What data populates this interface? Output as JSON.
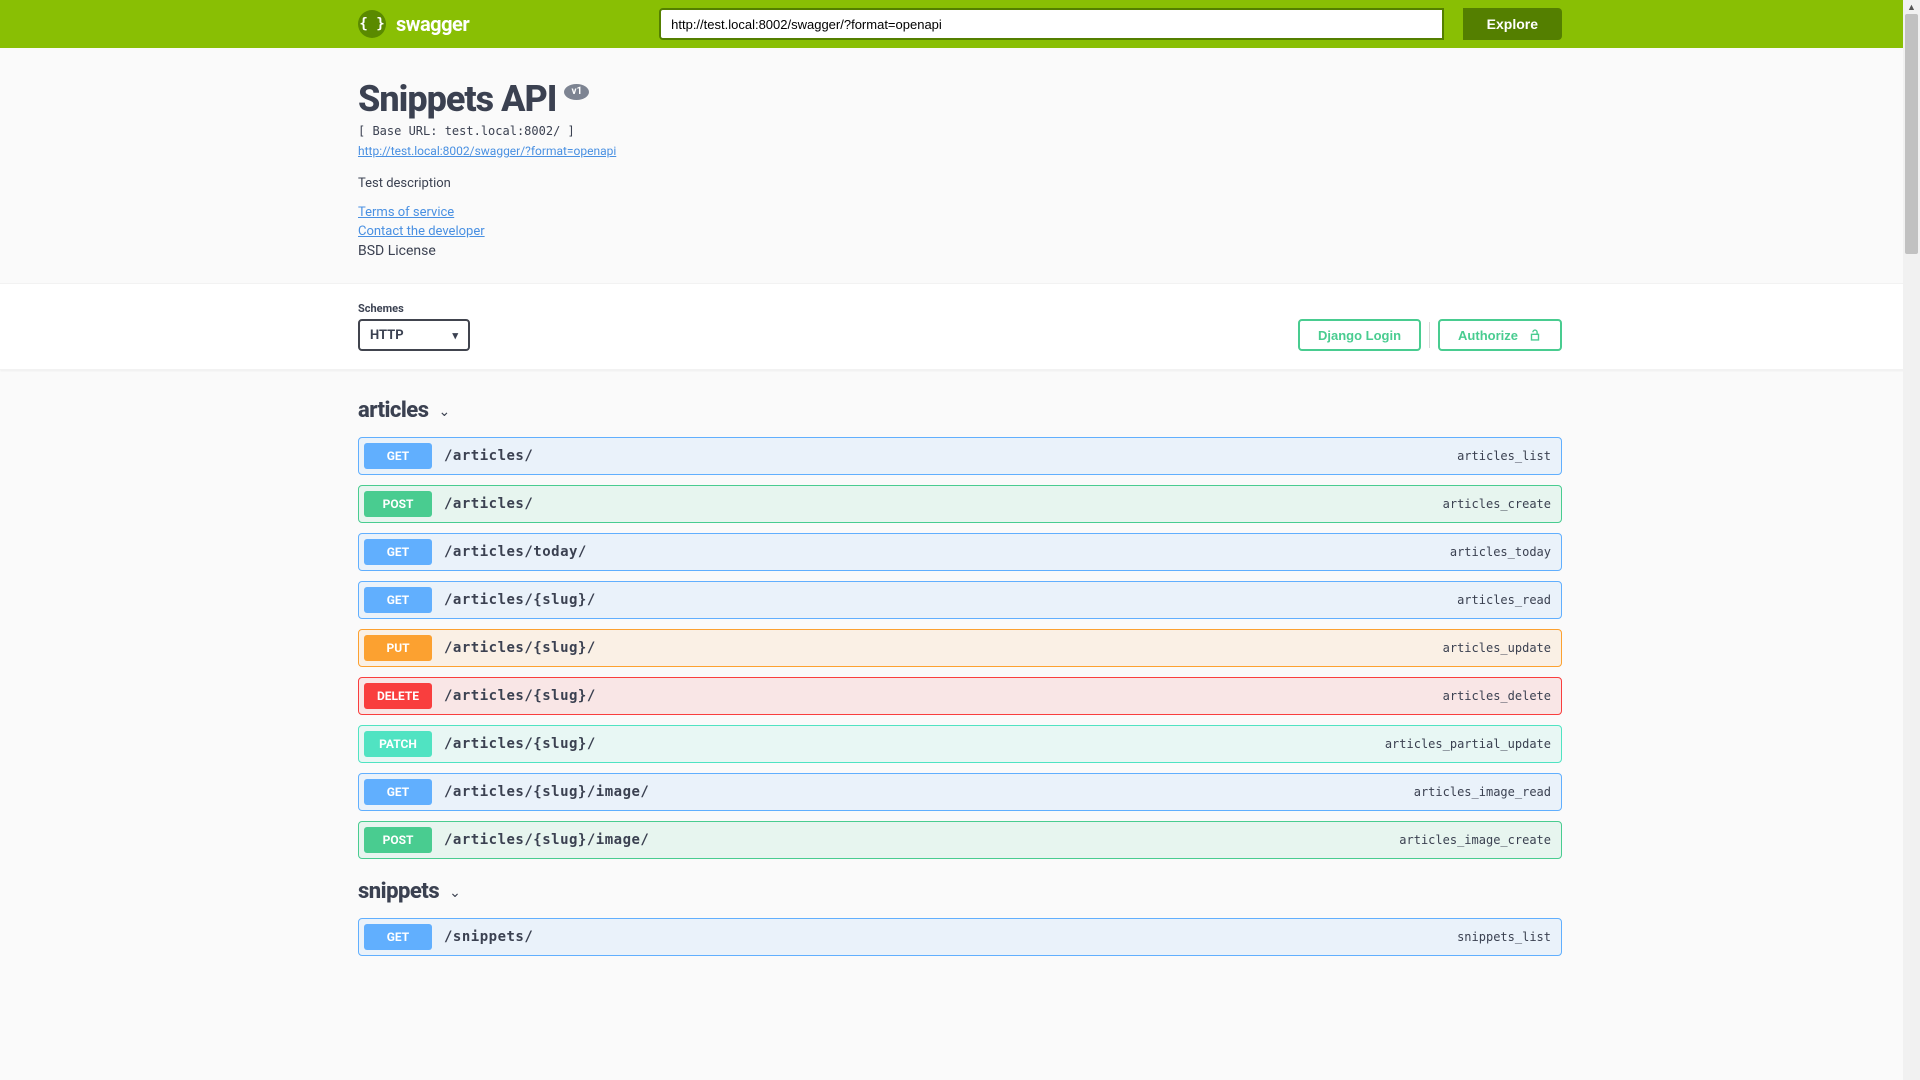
{
  "topbar": {
    "brand": "swagger",
    "url_value": "http://test.local:8002/swagger/?format=openapi",
    "explore_label": "Explore"
  },
  "info": {
    "title": "Snippets API",
    "version": "v1",
    "base_url": "[ Base URL: test.local:8002/ ]",
    "spec_link": "http://test.local:8002/swagger/?format=openapi",
    "description": "Test description",
    "terms": "Terms of service",
    "contact": "Contact the developer",
    "license": "BSD License"
  },
  "schemes": {
    "label": "Schemes",
    "selected": "HTTP"
  },
  "auth": {
    "django_login": "Django Login",
    "authorize": "Authorize"
  },
  "tags": {
    "articles": "articles",
    "snippets": "snippets"
  },
  "ops": {
    "a0": {
      "method": "GET",
      "path": "/articles/",
      "id": "articles_list"
    },
    "a1": {
      "method": "POST",
      "path": "/articles/",
      "id": "articles_create"
    },
    "a2": {
      "method": "GET",
      "path": "/articles/today/",
      "id": "articles_today"
    },
    "a3": {
      "method": "GET",
      "path": "/articles/{slug}/",
      "id": "articles_read"
    },
    "a4": {
      "method": "PUT",
      "path": "/articles/{slug}/",
      "id": "articles_update"
    },
    "a5": {
      "method": "DELETE",
      "path": "/articles/{slug}/",
      "id": "articles_delete"
    },
    "a6": {
      "method": "PATCH",
      "path": "/articles/{slug}/",
      "id": "articles_partial_update"
    },
    "a7": {
      "method": "GET",
      "path": "/articles/{slug}/image/",
      "id": "articles_image_read"
    },
    "a8": {
      "method": "POST",
      "path": "/articles/{slug}/image/",
      "id": "articles_image_create"
    },
    "s0": {
      "method": "GET",
      "path": "/snippets/",
      "id": "snippets_list"
    }
  }
}
